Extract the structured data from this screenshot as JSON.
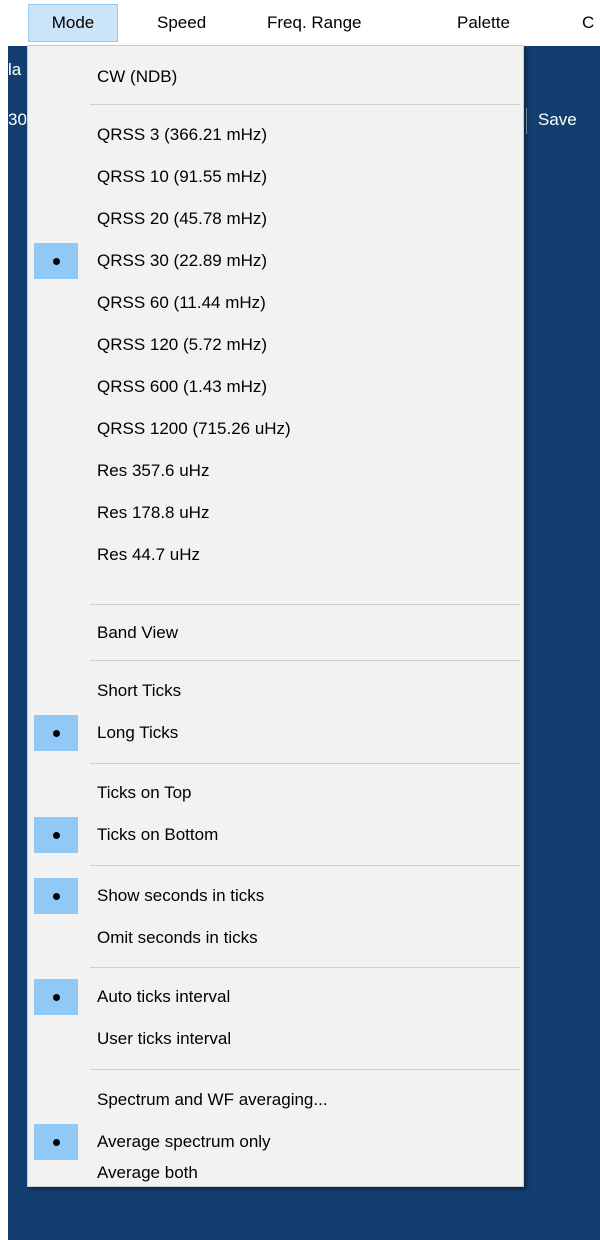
{
  "menubar": {
    "items": [
      {
        "label": "Mode"
      },
      {
        "label": "Speed"
      },
      {
        "label": "Freq. Range"
      },
      {
        "label": "Palette"
      },
      {
        "label": "C"
      }
    ]
  },
  "background": {
    "left_text_1": "la",
    "left_text_2": "30",
    "save_label": "Save"
  },
  "mode_menu": {
    "items": [
      {
        "label": "CW (NDB)",
        "checked": false
      },
      {
        "label": "QRSS 3 (366.21 mHz)",
        "checked": false
      },
      {
        "label": "QRSS 10 (91.55 mHz)",
        "checked": false
      },
      {
        "label": "QRSS 20 (45.78 mHz)",
        "checked": false
      },
      {
        "label": "QRSS 30 (22.89 mHz)",
        "checked": true
      },
      {
        "label": "QRSS 60 (11.44 mHz)",
        "checked": false
      },
      {
        "label": "QRSS 120 (5.72 mHz)",
        "checked": false
      },
      {
        "label": "QRSS 600 (1.43 mHz)",
        "checked": false
      },
      {
        "label": "QRSS 1200 (715.26 uHz)",
        "checked": false
      },
      {
        "label": "Res 357.6 uHz",
        "checked": false
      },
      {
        "label": "Res 178.8 uHz",
        "checked": false
      },
      {
        "label": "Res 44.7 uHz",
        "checked": false
      },
      {
        "label": "Band View",
        "checked": false
      },
      {
        "label": "Short Ticks",
        "checked": false
      },
      {
        "label": "Long Ticks",
        "checked": true
      },
      {
        "label": "Ticks on Top",
        "checked": false
      },
      {
        "label": "Ticks on Bottom",
        "checked": true
      },
      {
        "label": "Show seconds in ticks",
        "checked": true
      },
      {
        "label": "Omit seconds in ticks",
        "checked": false
      },
      {
        "label": "Auto ticks interval",
        "checked": true
      },
      {
        "label": "User ticks interval",
        "checked": false
      },
      {
        "label": "Spectrum and WF averaging...",
        "checked": false
      },
      {
        "label": "Average spectrum only",
        "checked": true
      },
      {
        "label": "Average both",
        "checked": false
      }
    ]
  },
  "colors": {
    "app_background": "#123f70",
    "menu_background": "#f2f2f2",
    "check_highlight": "#90c8f6",
    "menubar_active": "#cce4f7"
  }
}
